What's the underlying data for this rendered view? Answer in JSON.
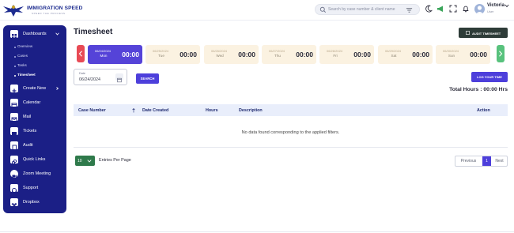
{
  "brand": {
    "name": "IMMIGRATION SPEED",
    "tagline": "SPEED THE PROCESS"
  },
  "search": {
    "placeholder": "Search by case number & client name"
  },
  "user": {
    "name": "Victoria",
    "role": "User"
  },
  "sidebar": {
    "items": [
      {
        "label": "Dashboards",
        "icon": "dashboard-icon"
      },
      {
        "label": "Create New",
        "icon": "create-icon"
      },
      {
        "label": "Calendar",
        "icon": "calendar-icon"
      },
      {
        "label": "Mail",
        "icon": "mail-icon"
      },
      {
        "label": "Tickets",
        "icon": "ticket-icon"
      },
      {
        "label": "Audit",
        "icon": "audit-icon"
      },
      {
        "label": "Quick Links",
        "icon": "link-icon"
      },
      {
        "label": "Zoom Meeting",
        "icon": "zoom-icon"
      },
      {
        "label": "Support",
        "icon": "support-icon"
      },
      {
        "label": "Dropbox",
        "icon": "dropbox-icon"
      }
    ],
    "subitems": [
      {
        "label": "Overview"
      },
      {
        "label": "Cases"
      },
      {
        "label": "Tasks"
      },
      {
        "label": "Timesheet"
      }
    ]
  },
  "page": {
    "title": "Timesheet",
    "audit_button": "AUDIT TIMESHEET",
    "log_button": "LOG YOUR TIME",
    "total_label": "Total Hours :",
    "total_value": "00:00",
    "total_unit": "Hrs"
  },
  "week": [
    {
      "date": "06/24/2024",
      "day": "Mon",
      "time": "00:00"
    },
    {
      "date": "06/25/2024",
      "day": "Tue",
      "time": "00:00"
    },
    {
      "date": "06/26/2024",
      "day": "Wed",
      "time": "00:00"
    },
    {
      "date": "06/27/2024",
      "day": "Thu",
      "time": "00:00"
    },
    {
      "date": "06/28/2024",
      "day": "Fri",
      "time": "00:00"
    },
    {
      "date": "06/29/2024",
      "day": "Sat",
      "time": "00:00"
    },
    {
      "date": "06/30/2024",
      "day": "Sun",
      "time": "00:00"
    }
  ],
  "date_filter": {
    "label": "Date",
    "value": "06/24/2024",
    "search_button": "SEARCH"
  },
  "table": {
    "columns": [
      "Case Number",
      "Date Created",
      "Hours",
      "Description",
      "Action"
    ],
    "empty_message": "No data found corresponding to the applied filters."
  },
  "pagination": {
    "per_page": "10",
    "per_page_label": "Entries Per Page",
    "previous": "Previous",
    "current": "1",
    "next": "Next"
  },
  "colors": {
    "sidebar": "#1b1f86",
    "accent": "#4d3fdb",
    "day_active": "#5543d8",
    "prev_arrow": "#e84a55",
    "next_arrow": "#58c27d"
  }
}
